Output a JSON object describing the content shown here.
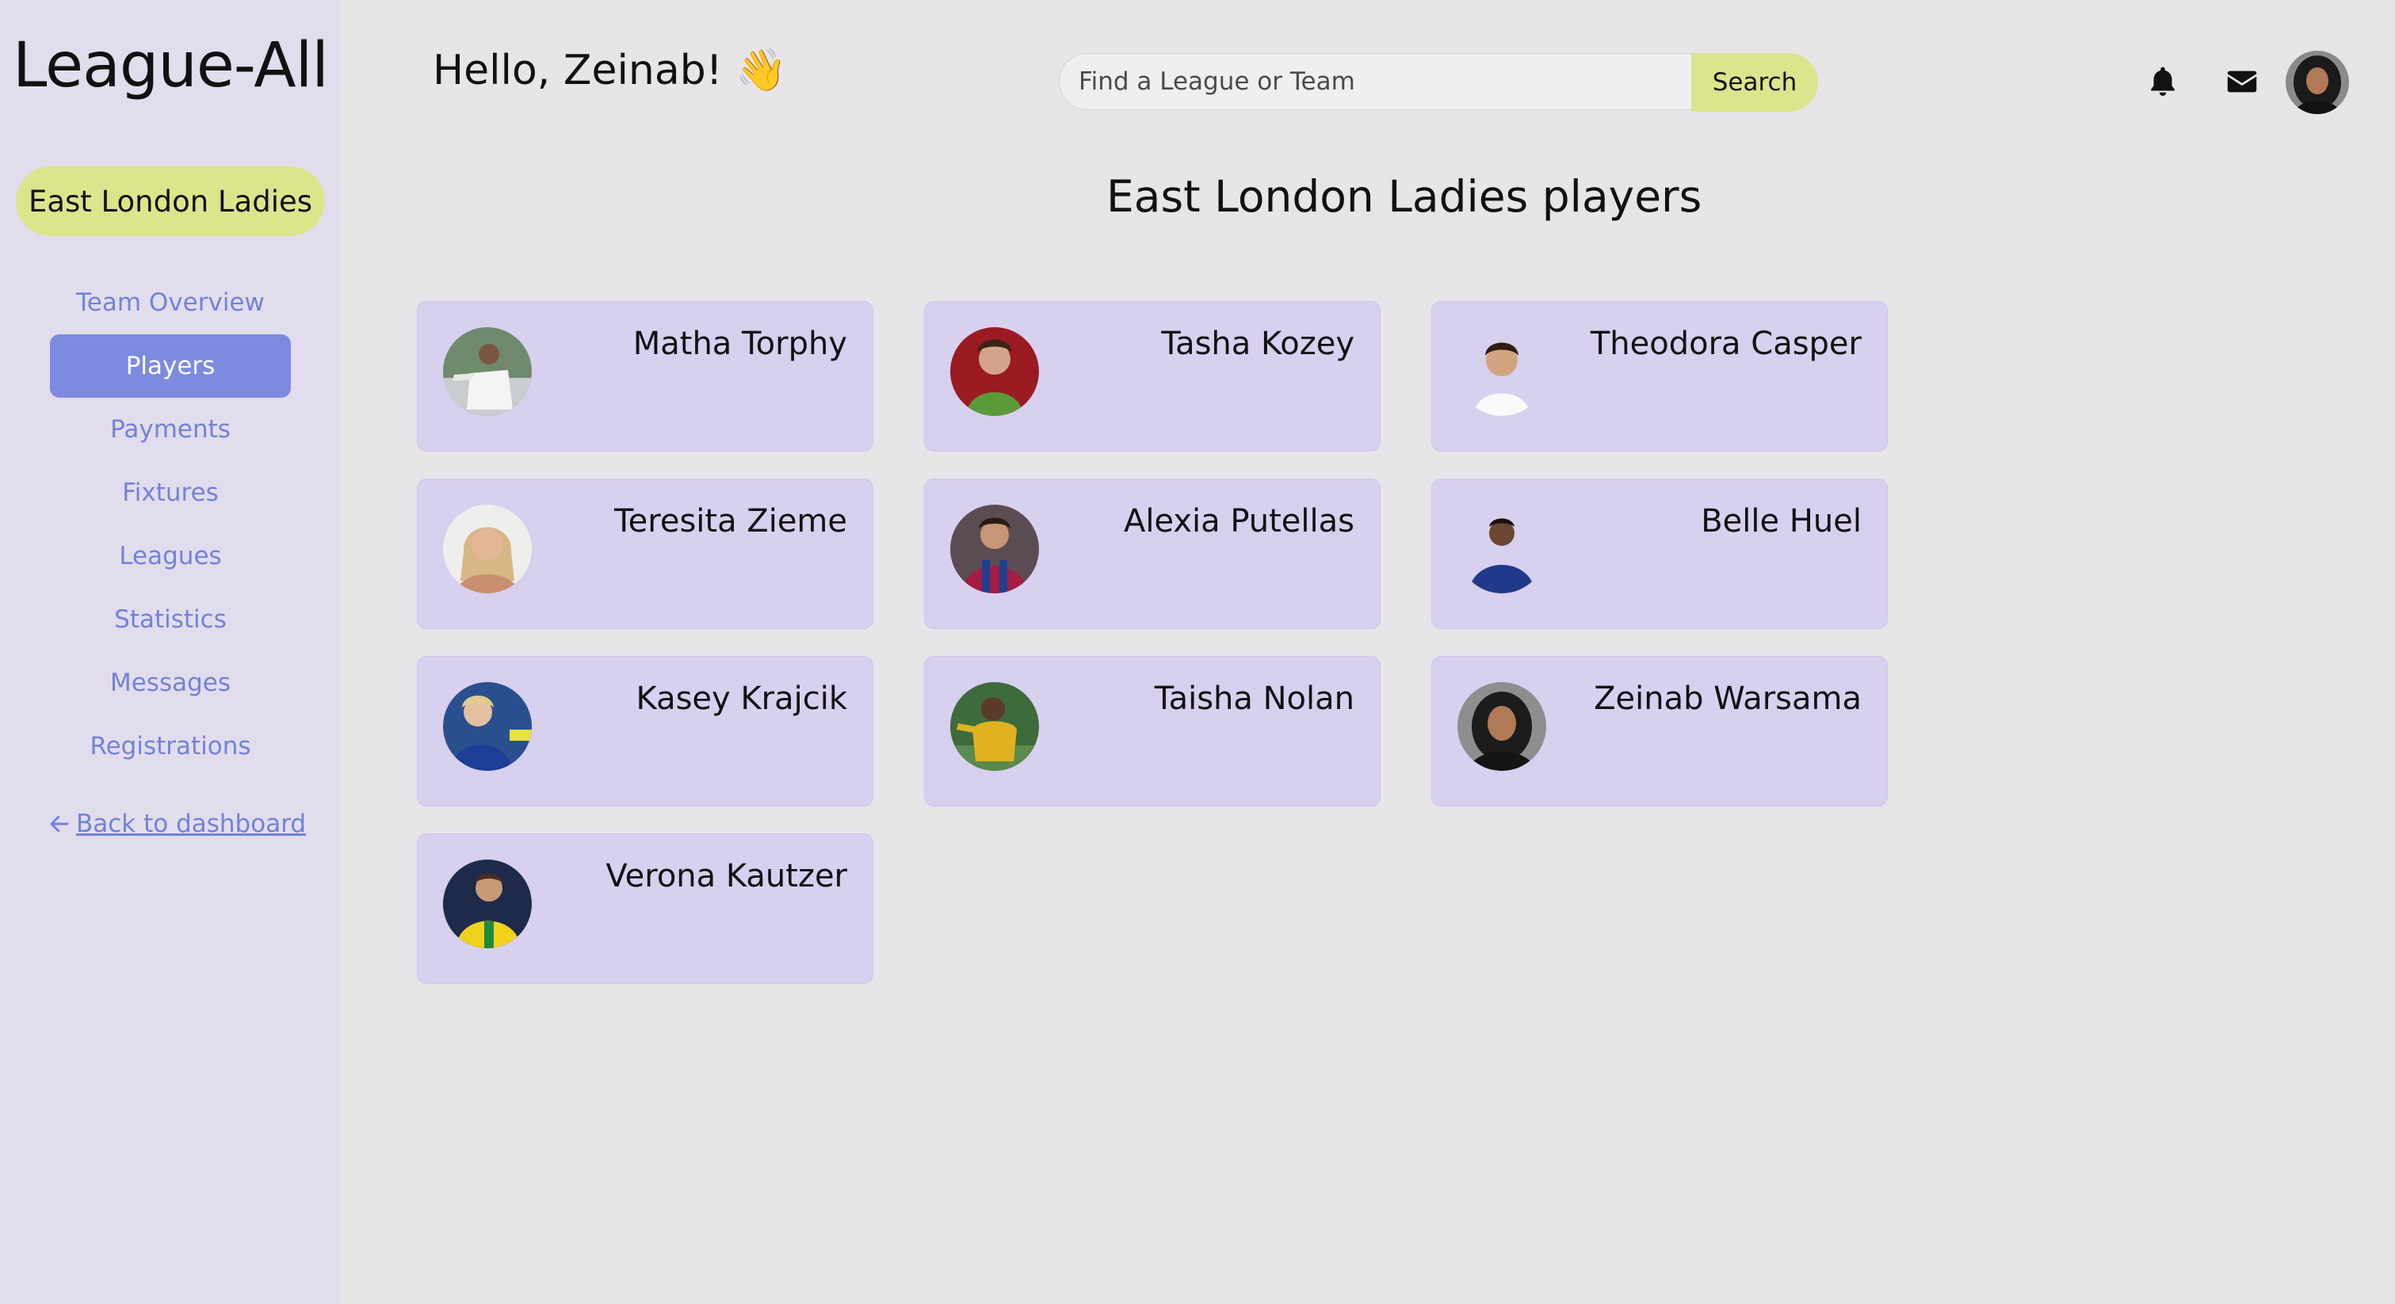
{
  "app": {
    "logo": "League-All"
  },
  "sidebar": {
    "team_name": "East London Ladies",
    "items": [
      {
        "label": "Team Overview",
        "active": false
      },
      {
        "label": "Players",
        "active": true
      },
      {
        "label": "Payments",
        "active": false
      },
      {
        "label": "Fixtures",
        "active": false
      },
      {
        "label": "Leagues",
        "active": false
      },
      {
        "label": "Statistics",
        "active": false
      },
      {
        "label": "Messages",
        "active": false
      },
      {
        "label": "Registrations",
        "active": false
      }
    ],
    "back_link": "Back to dashboard",
    "back_icon": "arrow-left-icon"
  },
  "header": {
    "greeting": "Hello, Zeinab! 👋",
    "search": {
      "placeholder": "Find a League or Team",
      "value": "",
      "button_label": "Search"
    },
    "icons": [
      "bell-icon",
      "envelope-icon",
      "user-avatar"
    ]
  },
  "main": {
    "title": "East London Ladies players",
    "players": [
      {
        "name": "Matha Torphy"
      },
      {
        "name": "Tasha Kozey"
      },
      {
        "name": "Theodora Casper"
      },
      {
        "name": "Teresita Zieme"
      },
      {
        "name": "Alexia Putellas"
      },
      {
        "name": "Belle Huel"
      },
      {
        "name": "Kasey Krajcik"
      },
      {
        "name": "Taisha Nolan"
      },
      {
        "name": "Zeinab Warsama"
      },
      {
        "name": "Verona Kautzer"
      }
    ]
  },
  "colors": {
    "accent_yellow": "#dbe58b",
    "accent_blue": "#7c8be0",
    "card_purple": "#d8d0ef",
    "sidebar_bg": "#e2ddec",
    "page_bg": "#e7e5e8"
  }
}
